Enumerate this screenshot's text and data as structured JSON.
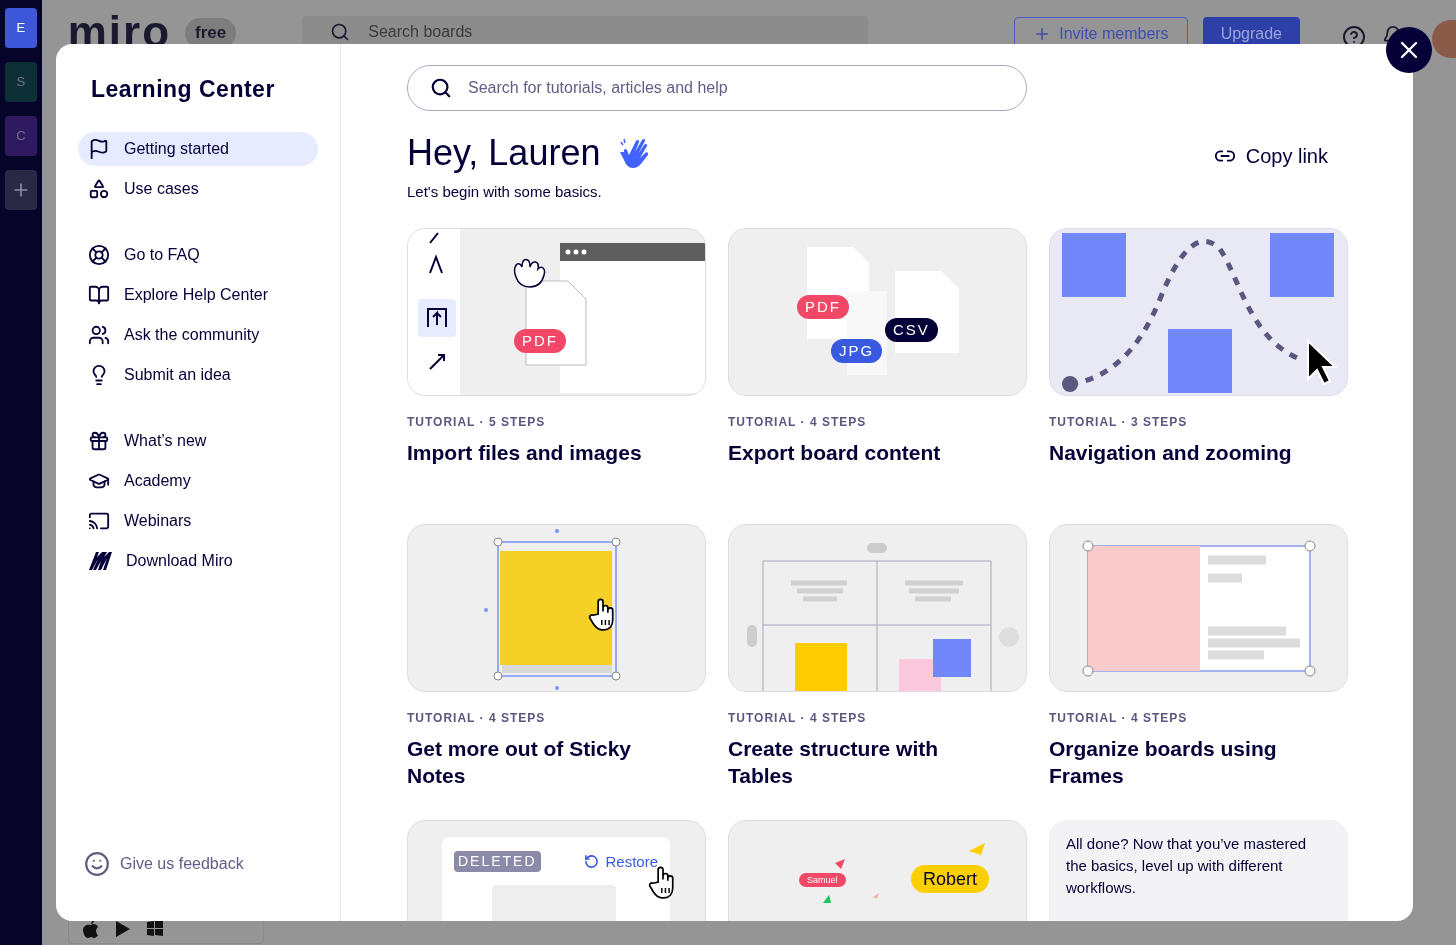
{
  "background_app": {
    "logo": "miro",
    "plan_badge": "free",
    "search_placeholder": "Search boards",
    "invite_button": "Invite members",
    "upgrade_button": "Upgrade",
    "workspaces": [
      {
        "label": "E",
        "selected": true,
        "color": "#3d57d8"
      },
      {
        "label": "S",
        "selected": false,
        "color": "#0f3a3a"
      },
      {
        "label": "C",
        "selected": false,
        "color": "#3a1f6e"
      }
    ]
  },
  "learning_center": {
    "title": "Learning Center",
    "nav_groups": [
      [
        {
          "label": "Getting started",
          "selected": true
        },
        {
          "label": "Use cases",
          "selected": false
        }
      ],
      [
        {
          "label": "Go to FAQ",
          "selected": false
        },
        {
          "label": "Explore Help Center",
          "selected": false
        },
        {
          "label": "Ask the community",
          "selected": false
        },
        {
          "label": "Submit an idea",
          "selected": false
        }
      ],
      [
        {
          "label": "What’s new",
          "selected": false
        },
        {
          "label": "Academy",
          "selected": false
        },
        {
          "label": "Webinars",
          "selected": false
        },
        {
          "label": "Download Miro",
          "selected": false
        }
      ]
    ],
    "feedback": "Give us feedback"
  },
  "search": {
    "placeholder": "Search for tutorials, articles and help"
  },
  "greeting": "Hey, Lauren",
  "subtitle": "Let's begin with some basics.",
  "copy_link": "Copy link",
  "tutorials": [
    {
      "kind": "import",
      "meta": "TUTORIAL · 5 STEPS",
      "title": "Import files and images",
      "tags": [
        "PDF"
      ]
    },
    {
      "kind": "export",
      "meta": "TUTORIAL · 4 STEPS",
      "title": "Export board content",
      "tags": [
        "PDF",
        "CSV",
        "JPG"
      ]
    },
    {
      "kind": "navigation",
      "meta": "TUTORIAL · 3 STEPS",
      "title": "Navigation and zooming"
    },
    {
      "kind": "sticky",
      "meta": "TUTORIAL · 4 STEPS",
      "title": "Get more out of Sticky Notes"
    },
    {
      "kind": "table",
      "meta": "TUTORIAL · 4 STEPS",
      "title": "Create structure with Tables"
    },
    {
      "kind": "frames",
      "meta": "TUTORIAL · 4 STEPS",
      "title": "Organize boards using Frames"
    }
  ],
  "more_cards": [
    {
      "kind": "restore",
      "badge": "DELETED",
      "action": "Restore"
    },
    {
      "kind": "cursors",
      "names": [
        "Samuel",
        "Robert"
      ]
    },
    {
      "kind": "note",
      "text": "All done? Now that you’ve mastered the basics, level up with different workflows."
    }
  ]
}
